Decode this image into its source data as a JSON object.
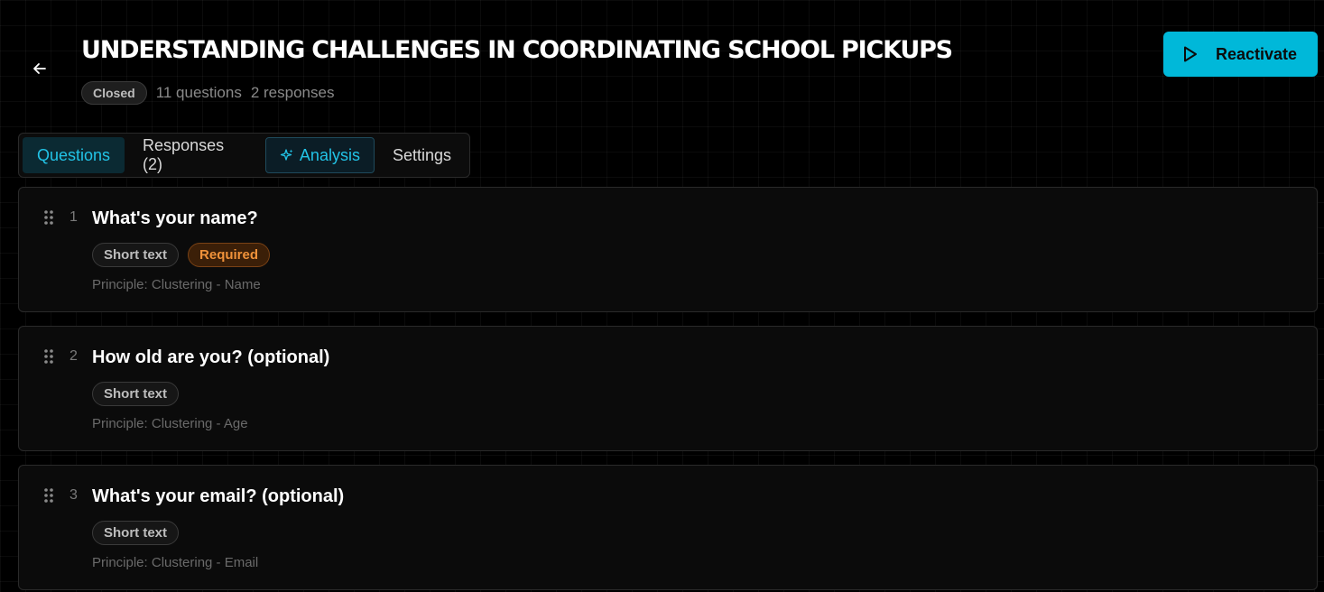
{
  "header": {
    "title": "UNDERSTANDING CHALLENGES IN COORDINATING SCHOOL PICKUPS",
    "status": "Closed",
    "questions_count": "11 questions",
    "responses_count": "2 responses",
    "reactivate_label": "Reactivate"
  },
  "tabs": [
    {
      "label": "Questions",
      "active": true
    },
    {
      "label": "Responses (2)"
    },
    {
      "label": "Analysis",
      "icon": "sparkle-icon"
    },
    {
      "label": "Settings"
    }
  ],
  "questions": [
    {
      "number": "1",
      "title": "What's your name?",
      "type": "Short text",
      "required": "Required",
      "principle": "Principle: Clustering - Name"
    },
    {
      "number": "2",
      "title": "How old are you? (optional)",
      "type": "Short text",
      "principle": "Principle: Clustering - Age"
    },
    {
      "number": "3",
      "title": "What's your email? (optional)",
      "type": "Short text",
      "principle": "Principle: Clustering - Email"
    }
  ],
  "colors": {
    "accent": "#00b8d9",
    "required": "#f0923a",
    "background": "#000000"
  }
}
